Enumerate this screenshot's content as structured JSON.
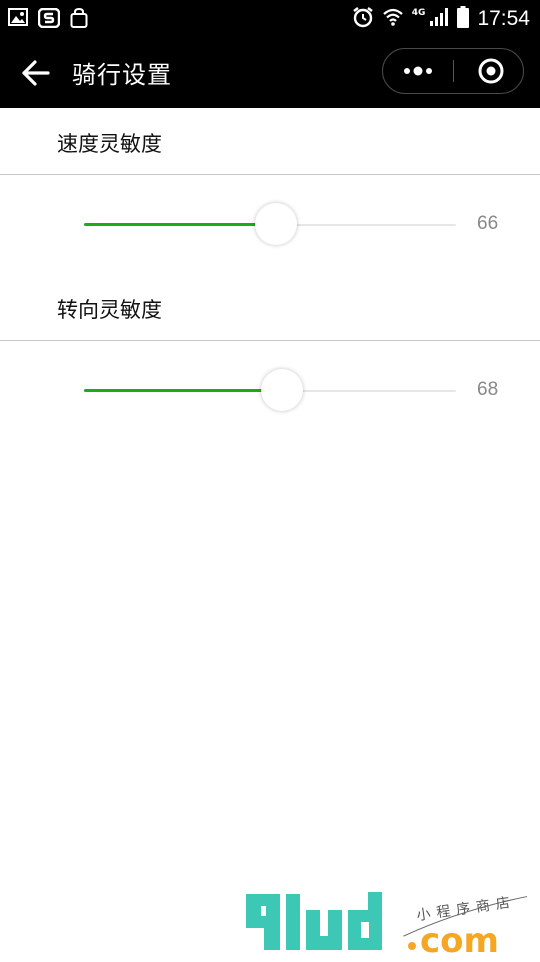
{
  "status_bar": {
    "time": "17:54",
    "network": "4G",
    "icons": [
      "image-icon",
      "app-s-icon",
      "shopping-bag-icon",
      "alarm-icon",
      "wifi-icon",
      "signal-icon",
      "battery-icon"
    ]
  },
  "nav": {
    "title": "骑行设置",
    "back_icon": "arrow-left-icon",
    "more_icon": "more-dots-icon",
    "close_icon": "target-close-icon"
  },
  "settings": [
    {
      "label": "速度灵敏度",
      "value": 66,
      "fraction": 0.515
    },
    {
      "label": "转向灵敏度",
      "value": 68,
      "fraction": 0.532
    }
  ],
  "colors": {
    "accent": "#1aad19",
    "header": "#000000",
    "value_text": "#888888",
    "watermark_teal": "#3cc8b4",
    "watermark_orange": "#f5a623"
  },
  "watermark": {
    "brand": "91ud",
    "domain": ".com",
    "tagline": "小程序商店"
  }
}
